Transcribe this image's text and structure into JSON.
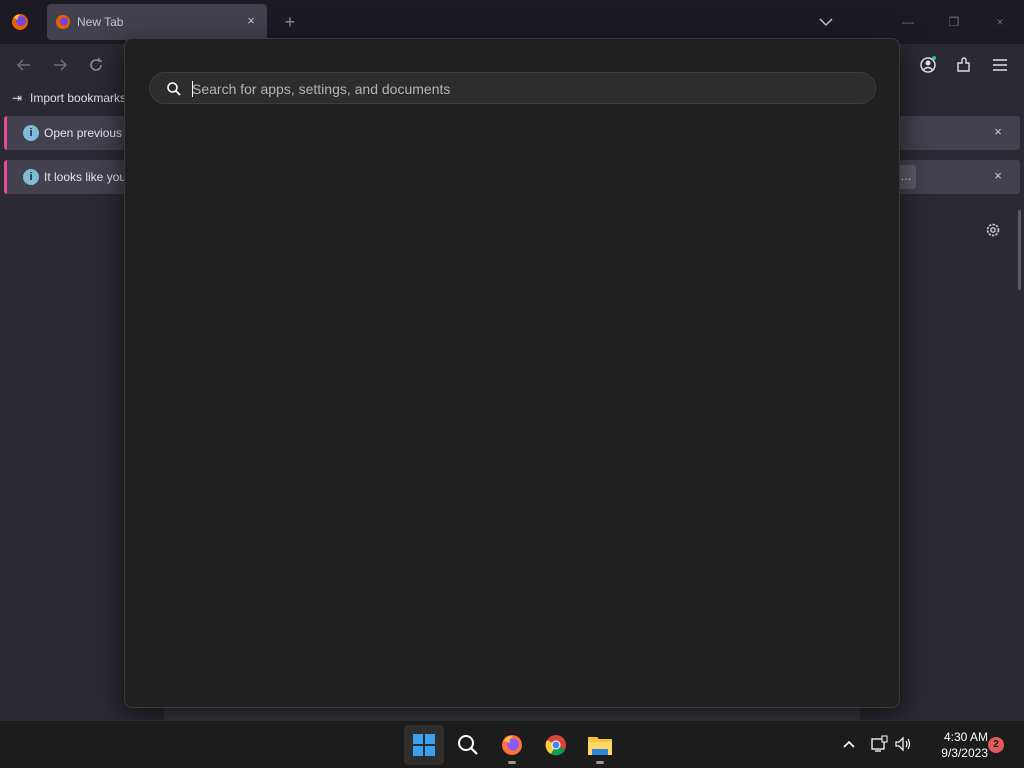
{
  "browser": {
    "tab_title": "New Tab",
    "tab_close": "×",
    "new_tab": "+",
    "window_controls": [
      "—",
      "❐",
      "×"
    ],
    "bookmarks": {
      "import_label": "Import bookmarks…"
    },
    "infobars": [
      {
        "text": "Open previous …",
        "close": "×"
      },
      {
        "text": "It looks like you…",
        "button": "…",
        "close": "×"
      }
    ]
  },
  "search": {
    "placeholder": "Search for apps, settings, and documents",
    "value": ""
  },
  "taskbar": {
    "apps": [
      "start-icon",
      "search-icon",
      "firefox-icon",
      "chrome-icon",
      "file-explorer-icon"
    ],
    "time": "4:30 AM",
    "date": "9/3/2023",
    "notification_count": "2"
  },
  "colors": {
    "accent_pink": "#e84b9e",
    "windows_blue": "#3aa0f3",
    "info_blue": "#7fbcd8"
  }
}
